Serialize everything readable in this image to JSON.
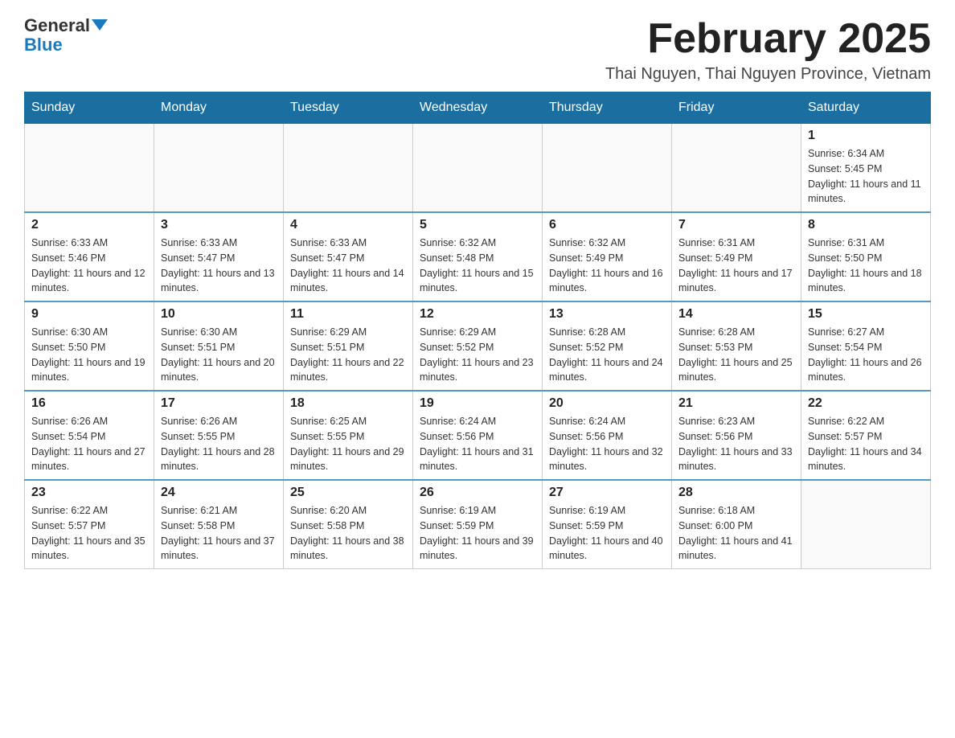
{
  "logo": {
    "text_general": "General",
    "text_blue": "Blue"
  },
  "header": {
    "title": "February 2025",
    "subtitle": "Thai Nguyen, Thai Nguyen Province, Vietnam"
  },
  "weekdays": [
    "Sunday",
    "Monday",
    "Tuesday",
    "Wednesday",
    "Thursday",
    "Friday",
    "Saturday"
  ],
  "weeks": [
    [
      {
        "day": "",
        "info": ""
      },
      {
        "day": "",
        "info": ""
      },
      {
        "day": "",
        "info": ""
      },
      {
        "day": "",
        "info": ""
      },
      {
        "day": "",
        "info": ""
      },
      {
        "day": "",
        "info": ""
      },
      {
        "day": "1",
        "info": "Sunrise: 6:34 AM\nSunset: 5:45 PM\nDaylight: 11 hours and 11 minutes."
      }
    ],
    [
      {
        "day": "2",
        "info": "Sunrise: 6:33 AM\nSunset: 5:46 PM\nDaylight: 11 hours and 12 minutes."
      },
      {
        "day": "3",
        "info": "Sunrise: 6:33 AM\nSunset: 5:47 PM\nDaylight: 11 hours and 13 minutes."
      },
      {
        "day": "4",
        "info": "Sunrise: 6:33 AM\nSunset: 5:47 PM\nDaylight: 11 hours and 14 minutes."
      },
      {
        "day": "5",
        "info": "Sunrise: 6:32 AM\nSunset: 5:48 PM\nDaylight: 11 hours and 15 minutes."
      },
      {
        "day": "6",
        "info": "Sunrise: 6:32 AM\nSunset: 5:49 PM\nDaylight: 11 hours and 16 minutes."
      },
      {
        "day": "7",
        "info": "Sunrise: 6:31 AM\nSunset: 5:49 PM\nDaylight: 11 hours and 17 minutes."
      },
      {
        "day": "8",
        "info": "Sunrise: 6:31 AM\nSunset: 5:50 PM\nDaylight: 11 hours and 18 minutes."
      }
    ],
    [
      {
        "day": "9",
        "info": "Sunrise: 6:30 AM\nSunset: 5:50 PM\nDaylight: 11 hours and 19 minutes."
      },
      {
        "day": "10",
        "info": "Sunrise: 6:30 AM\nSunset: 5:51 PM\nDaylight: 11 hours and 20 minutes."
      },
      {
        "day": "11",
        "info": "Sunrise: 6:29 AM\nSunset: 5:51 PM\nDaylight: 11 hours and 22 minutes."
      },
      {
        "day": "12",
        "info": "Sunrise: 6:29 AM\nSunset: 5:52 PM\nDaylight: 11 hours and 23 minutes."
      },
      {
        "day": "13",
        "info": "Sunrise: 6:28 AM\nSunset: 5:52 PM\nDaylight: 11 hours and 24 minutes."
      },
      {
        "day": "14",
        "info": "Sunrise: 6:28 AM\nSunset: 5:53 PM\nDaylight: 11 hours and 25 minutes."
      },
      {
        "day": "15",
        "info": "Sunrise: 6:27 AM\nSunset: 5:54 PM\nDaylight: 11 hours and 26 minutes."
      }
    ],
    [
      {
        "day": "16",
        "info": "Sunrise: 6:26 AM\nSunset: 5:54 PM\nDaylight: 11 hours and 27 minutes."
      },
      {
        "day": "17",
        "info": "Sunrise: 6:26 AM\nSunset: 5:55 PM\nDaylight: 11 hours and 28 minutes."
      },
      {
        "day": "18",
        "info": "Sunrise: 6:25 AM\nSunset: 5:55 PM\nDaylight: 11 hours and 29 minutes."
      },
      {
        "day": "19",
        "info": "Sunrise: 6:24 AM\nSunset: 5:56 PM\nDaylight: 11 hours and 31 minutes."
      },
      {
        "day": "20",
        "info": "Sunrise: 6:24 AM\nSunset: 5:56 PM\nDaylight: 11 hours and 32 minutes."
      },
      {
        "day": "21",
        "info": "Sunrise: 6:23 AM\nSunset: 5:56 PM\nDaylight: 11 hours and 33 minutes."
      },
      {
        "day": "22",
        "info": "Sunrise: 6:22 AM\nSunset: 5:57 PM\nDaylight: 11 hours and 34 minutes."
      }
    ],
    [
      {
        "day": "23",
        "info": "Sunrise: 6:22 AM\nSunset: 5:57 PM\nDaylight: 11 hours and 35 minutes."
      },
      {
        "day": "24",
        "info": "Sunrise: 6:21 AM\nSunset: 5:58 PM\nDaylight: 11 hours and 37 minutes."
      },
      {
        "day": "25",
        "info": "Sunrise: 6:20 AM\nSunset: 5:58 PM\nDaylight: 11 hours and 38 minutes."
      },
      {
        "day": "26",
        "info": "Sunrise: 6:19 AM\nSunset: 5:59 PM\nDaylight: 11 hours and 39 minutes."
      },
      {
        "day": "27",
        "info": "Sunrise: 6:19 AM\nSunset: 5:59 PM\nDaylight: 11 hours and 40 minutes."
      },
      {
        "day": "28",
        "info": "Sunrise: 6:18 AM\nSunset: 6:00 PM\nDaylight: 11 hours and 41 minutes."
      },
      {
        "day": "",
        "info": ""
      }
    ]
  ]
}
